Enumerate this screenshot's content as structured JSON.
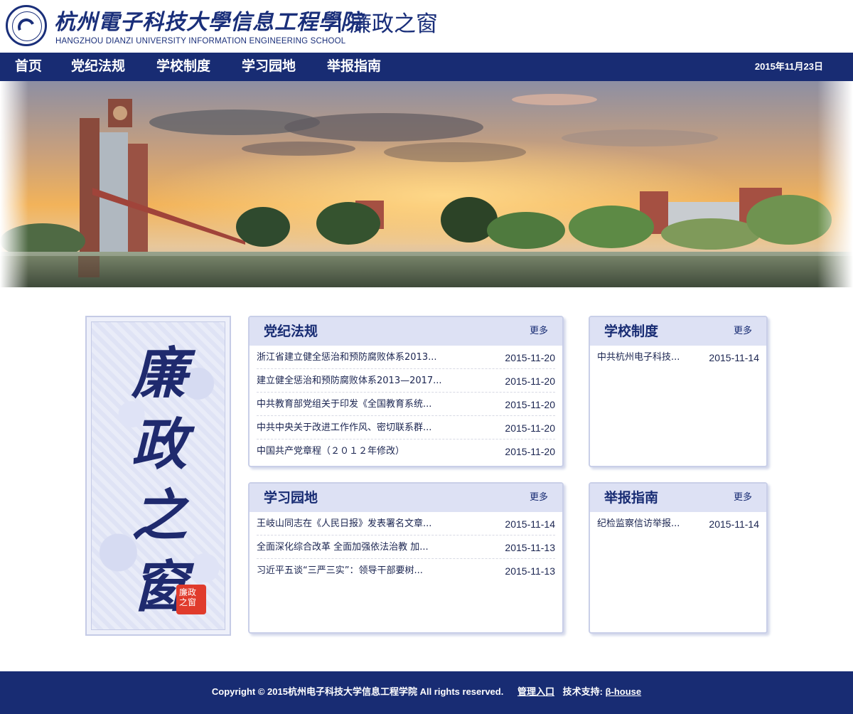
{
  "header": {
    "school_name_cn": "杭州電子科技大學信息工程學院",
    "school_name_en": "HANGZHOU DIANZI UNIVERSITY INFORMATION ENGINEERING SCHOOL",
    "site_title": "廉政之窗"
  },
  "nav": {
    "items": [
      {
        "label": "首页"
      },
      {
        "label": "党纪法规"
      },
      {
        "label": "学校制度"
      },
      {
        "label": "学习园地"
      },
      {
        "label": "举报指南"
      }
    ],
    "date": "2015年11月23日"
  },
  "side_art": {
    "calligraphy": "廉政之窗",
    "stamp": "廉政之窗"
  },
  "panels": {
    "party_rules": {
      "title": "党纪法规",
      "more": "更多",
      "items": [
        {
          "title": "浙江省建立健全惩治和预防腐败体系2013...",
          "date": "2015-11-20"
        },
        {
          "title": "建立健全惩治和预防腐败体系2013—2017...",
          "date": "2015-11-20"
        },
        {
          "title": "中共教育部党组关于印发《全国教育系统...",
          "date": "2015-11-20"
        },
        {
          "title": "中共中央关于改进工作作风、密切联系群...",
          "date": "2015-11-20"
        },
        {
          "title": "中国共产党章程（２０１２年修改）",
          "date": "2015-11-20"
        }
      ]
    },
    "school_rules": {
      "title": "学校制度",
      "more": "更多",
      "items": [
        {
          "title": "中共杭州电子科技...",
          "date": "2015-11-14"
        }
      ]
    },
    "study": {
      "title": "学习园地",
      "more": "更多",
      "items": [
        {
          "title": "王岐山同志在《人民日报》发表署名文章...",
          "date": "2015-11-14"
        },
        {
          "title": "全面深化综合改革 全面加强依法治教 加...",
          "date": "2015-11-13"
        },
        {
          "title": "习近平五谈“三严三实”：领导干部要树...",
          "date": "2015-11-13"
        }
      ]
    },
    "report": {
      "title": "举报指南",
      "more": "更多",
      "items": [
        {
          "title": "纪检监察信访举报...",
          "date": "2015-11-14"
        }
      ]
    }
  },
  "footer": {
    "copyright": "Copyright © 2015杭州电子科技大学信息工程学院 All rights reserved.",
    "admin_link": "管理入口",
    "support_label": "技术支持:",
    "support_link": "β-house"
  },
  "colors": {
    "brand_navy": "#182c73",
    "panel_head": "#dde1f4",
    "panel_border": "#c9cfe8"
  }
}
